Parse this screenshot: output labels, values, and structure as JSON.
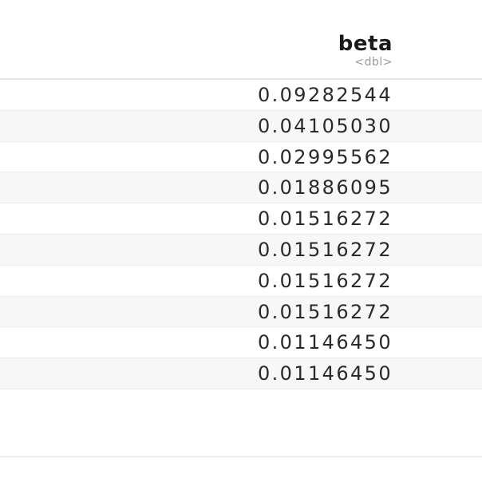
{
  "table": {
    "column": {
      "name": "beta",
      "type": "<dbl>"
    },
    "rows": [
      {
        "beta": "0.09282544"
      },
      {
        "beta": "0.04105030"
      },
      {
        "beta": "0.02995562"
      },
      {
        "beta": "0.01886095"
      },
      {
        "beta": "0.01516272"
      },
      {
        "beta": "0.01516272"
      },
      {
        "beta": "0.01516272"
      },
      {
        "beta": "0.01516272"
      },
      {
        "beta": "0.01146450"
      },
      {
        "beta": "0.01146450"
      }
    ]
  }
}
